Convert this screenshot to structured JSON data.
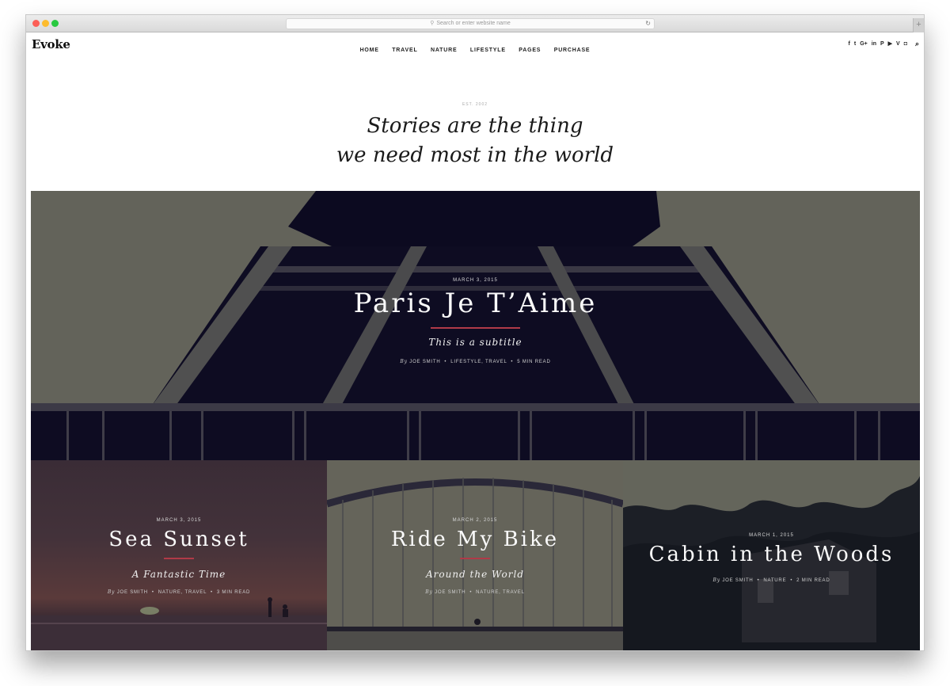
{
  "browser": {
    "url_placeholder": "Search or enter website name",
    "search_icon": "magnifier-icon",
    "reload_icon": "↻",
    "new_tab_icon": "+"
  },
  "site": {
    "logo": "Evoke",
    "nav": [
      "HOME",
      "TRAVEL",
      "NATURE",
      "LIFESTYLE",
      "PAGES",
      "PURCHASE"
    ],
    "social": [
      {
        "name": "facebook",
        "glyph": "f"
      },
      {
        "name": "twitter",
        "glyph": "t"
      },
      {
        "name": "google-plus",
        "glyph": "G+"
      },
      {
        "name": "linkedin",
        "glyph": "in"
      },
      {
        "name": "pinterest",
        "glyph": "P"
      },
      {
        "name": "youtube",
        "glyph": "▶"
      },
      {
        "name": "vimeo",
        "glyph": "V"
      },
      {
        "name": "instagram",
        "glyph": "◘"
      }
    ],
    "search_glyph": "⌕"
  },
  "intro": {
    "est": "EST. 2002",
    "tagline_line1": "Stories are the thing",
    "tagline_line2": "we need most in the world"
  },
  "featured": {
    "date": "MARCH 3, 2015",
    "title": "Paris Je T’Aime",
    "subtitle": "This is a subtitle",
    "by": "By",
    "author": "JOE SMITH",
    "categories": "LIFESTYLE, TRAVEL",
    "read_time": "5 MIN READ",
    "accent_color": "#b03a48"
  },
  "posts": [
    {
      "date": "MARCH 3, 2015",
      "title": "Sea Sunset",
      "subtitle": "A Fantastic Time",
      "by": "By",
      "author": "JOE SMITH",
      "categories": "NATURE, TRAVEL",
      "read_time": "3 MIN READ"
    },
    {
      "date": "MARCH 2, 2015",
      "title": "Ride My Bike",
      "subtitle": "Around the World",
      "by": "By",
      "author": "JOE SMITH",
      "categories": "NATURE, TRAVEL"
    },
    {
      "date": "MARCH 1, 2015",
      "title": "Cabin in the Woods",
      "by": "By",
      "author": "JOE SMITH",
      "categories": "NATURE",
      "read_time": "2 MIN READ"
    }
  ],
  "separator": "•"
}
